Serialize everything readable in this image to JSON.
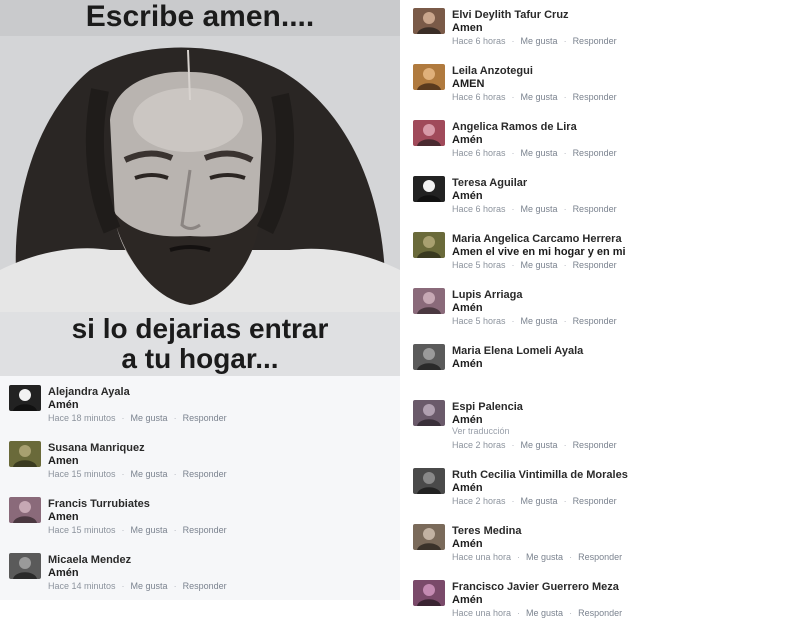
{
  "meme": {
    "top_text": "Escribe amen....",
    "bottom_line1": "si lo dejarias entrar",
    "bottom_line2": "a tu hogar..."
  },
  "left_comments": [
    {
      "name": "Alejandra Ayala",
      "text": "Amén",
      "time": "Hace 18 minutos",
      "like": "Me gusta",
      "reply": "Responder"
    },
    {
      "name": "Susana Manriquez",
      "text": "Amen",
      "time": "Hace 15 minutos",
      "like": "Me gusta",
      "reply": "Responder"
    },
    {
      "name": "Francis Turrubiates",
      "text": "Amen",
      "time": "Hace 15 minutos",
      "like": "Me gusta",
      "reply": "Responder"
    },
    {
      "name": "Micaela Mendez",
      "text": "Amén",
      "time": "Hace 14 minutos",
      "like": "Me gusta",
      "reply": "Responder"
    }
  ],
  "right_comments": [
    {
      "name": "Elvi Deylith Tafur Cruz",
      "text": "Amen",
      "time": "Hace 6 horas",
      "like": "Me gusta",
      "reply": "Responder"
    },
    {
      "name": "Leila Anzotegui",
      "text": "AMEN",
      "time": "Hace 6 horas",
      "like": "Me gusta",
      "reply": "Responder"
    },
    {
      "name": "Angelica Ramos de Lira",
      "text": "Amén",
      "time": "Hace 6 horas",
      "like": "Me gusta",
      "reply": "Responder"
    },
    {
      "name": "Teresa Aguilar",
      "text": "Amén",
      "time": "Hace 6 horas",
      "like": "Me gusta",
      "reply": "Responder"
    },
    {
      "name": "Maria Angelica Carcamo Herrera",
      "text": "Amen el vive en mi hogar y en mi",
      "time": "Hace 5 horas",
      "like": "Me gusta",
      "reply": "Responder"
    },
    {
      "name": "Lupis Arriaga",
      "text": "Amén",
      "time": "Hace 5 horas",
      "like": "Me gusta",
      "reply": "Responder"
    },
    {
      "name": "Maria Elena Lomeli Ayala",
      "text": "Amén",
      "time": "",
      "like": "",
      "reply": ""
    },
    {
      "name": "Espi Palencia",
      "text": "Amén",
      "extra": "Ver traducción",
      "time": "Hace 2 horas",
      "like": "Me gusta",
      "reply": "Responder"
    },
    {
      "name": "Ruth Cecilia Vintimilla de Morales",
      "text": "Amén",
      "time": "Hace 2 horas",
      "like": "Me gusta",
      "reply": "Responder"
    },
    {
      "name": "Teres Medina",
      "text": "Amén",
      "time": "Hace una hora",
      "like": "Me gusta",
      "reply": "Responder"
    },
    {
      "name": "Francisco Javier Guerrero Meza",
      "text": "Amén",
      "time": "Hace una hora",
      "like": "Me gusta",
      "reply": "Responder"
    }
  ]
}
